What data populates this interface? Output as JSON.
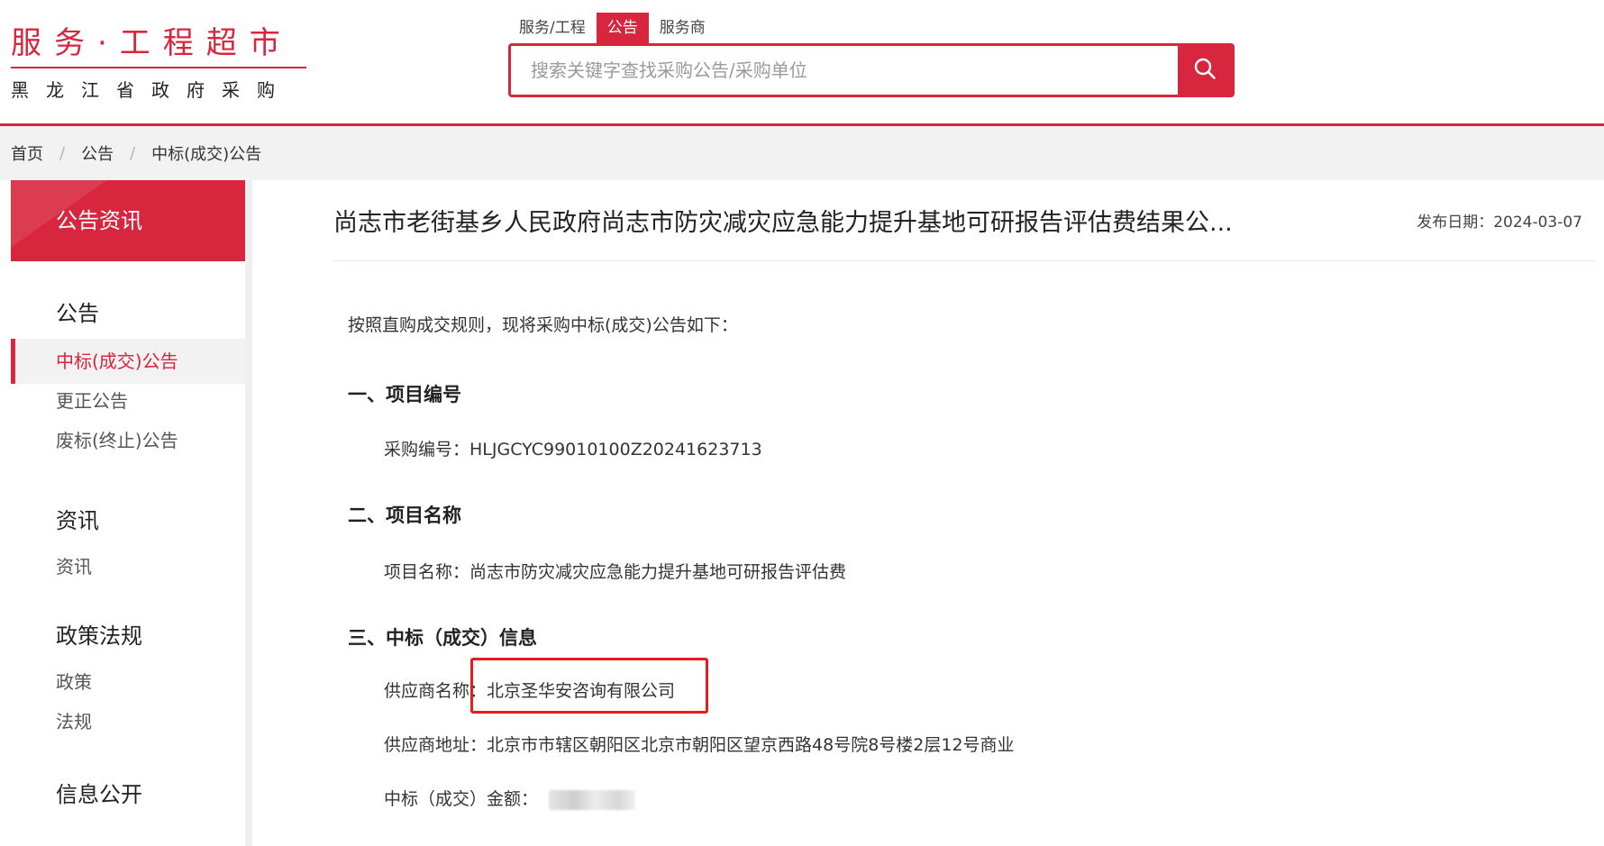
{
  "logo": {
    "title": "服务·工程超市",
    "subtitle": "黑龙江省政府采购"
  },
  "search": {
    "tabs": [
      {
        "label": "服务/工程",
        "active": false
      },
      {
        "label": "公告",
        "active": true
      },
      {
        "label": "服务商",
        "active": false
      }
    ],
    "placeholder": "搜索关键字查找采购公告/采购单位",
    "button_icon": "search-icon"
  },
  "breadcrumb": [
    "首页",
    "公告",
    "中标(成交)公告"
  ],
  "sidebar": {
    "header": "公告资讯",
    "groups": [
      {
        "title": "公告",
        "items": [
          {
            "label": "中标(成交)公告",
            "active": true
          },
          {
            "label": "更正公告",
            "active": false
          },
          {
            "label": "废标(终止)公告",
            "active": false
          }
        ]
      },
      {
        "title": "资讯",
        "items": [
          {
            "label": "资讯",
            "active": false
          }
        ]
      },
      {
        "title": "政策法规",
        "items": [
          {
            "label": "政策",
            "active": false
          },
          {
            "label": "法规",
            "active": false
          }
        ]
      },
      {
        "title": "信息公开",
        "items": []
      }
    ]
  },
  "article": {
    "title": "尚志市老街基乡人民政府尚志市防灾减灾应急能力提升基地可研报告评估费结果公...",
    "publish_date_label": "发布日期：",
    "publish_date": "2024-03-07",
    "intro": "按照直购成交规则，现将采购中标(成交)公告如下：",
    "sections": [
      {
        "heading": "一、项目编号",
        "fields": [
          {
            "label": "采购编号：",
            "value": "HLJGCYC99010100Z20241623713"
          }
        ]
      },
      {
        "heading": "二、项目名称",
        "fields": [
          {
            "label": "项目名称：",
            "value": "尚志市防灾减灾应急能力提升基地可研报告评估费"
          }
        ]
      },
      {
        "heading": "三、中标（成交）信息",
        "fields": [
          {
            "label": "供应商名称：",
            "value": "北京圣华安咨询有限公司"
          },
          {
            "label": "供应商地址：",
            "value": "北京市市辖区朝阳区北京市朝阳区望京西路48号院8号楼2层12号商业"
          },
          {
            "label": "中标（成交）金额：",
            "value": ""
          }
        ]
      }
    ]
  },
  "colors": {
    "brand_red": "#d7263d",
    "annotation_red": "#e41e1e",
    "breadcrumb_bg": "#f2f2f2"
  }
}
